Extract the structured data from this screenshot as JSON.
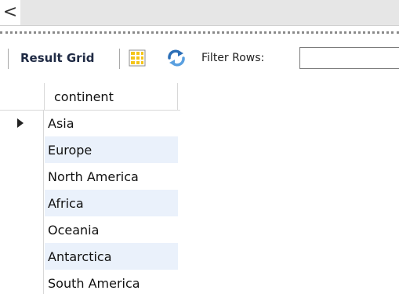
{
  "scroll": {
    "left_arrow": "<"
  },
  "toolbar": {
    "result_grid_label": "Result Grid",
    "filter_label": "Filter Rows:",
    "filter_value": ""
  },
  "grid": {
    "header": "continent",
    "rows": [
      "Asia",
      "Europe",
      "North America",
      "Africa",
      "Oceania",
      "Antarctica",
      "South America"
    ],
    "selected_row": 0
  },
  "colors": {
    "alt_row": "#eaf1fb",
    "grid_icon_yellow": "#f5c518",
    "refresh_icon_blue": "#2c6fb7"
  }
}
